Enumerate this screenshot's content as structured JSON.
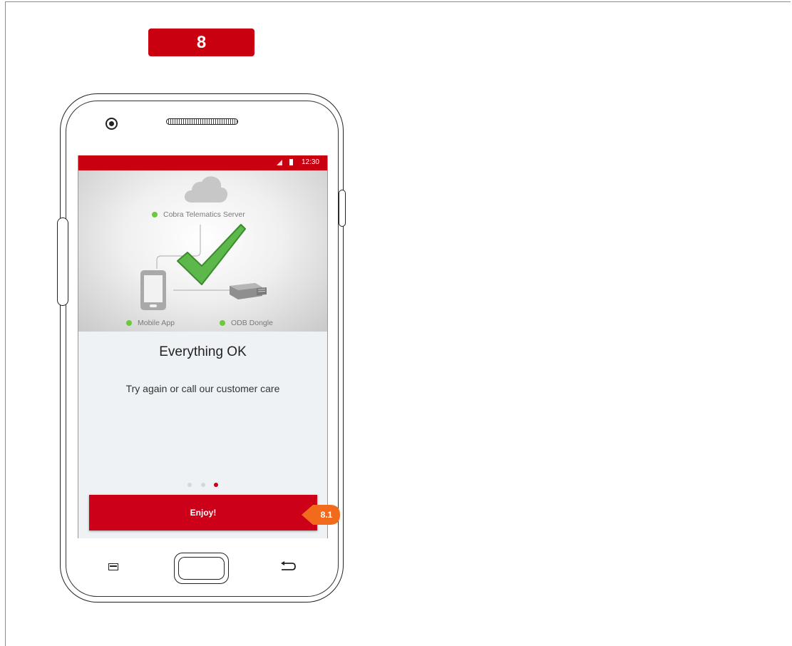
{
  "step_badge": "8",
  "screen": {
    "status_time": "12:30",
    "hero": {
      "server_label": "Cobra Telematics Server",
      "app_label": "Mobile App",
      "dongle_label": "ODB Dongle"
    },
    "title": "Everything OK",
    "subtitle": "Try again or call our customer care",
    "pager": {
      "count": 3,
      "active": 3
    },
    "primary_button_label": "Enjoy!"
  },
  "callout": "8.1",
  "colors": {
    "brand_red": "#c8000f",
    "status_ok_green": "#6cc93c",
    "check_green": "#5cb84a",
    "callout_orange": "#f26a1b"
  },
  "icons": [
    "cloud-icon",
    "phone-icon",
    "dongle-icon",
    "checkmark-icon",
    "menu-icon",
    "home-button",
    "back-icon"
  ]
}
